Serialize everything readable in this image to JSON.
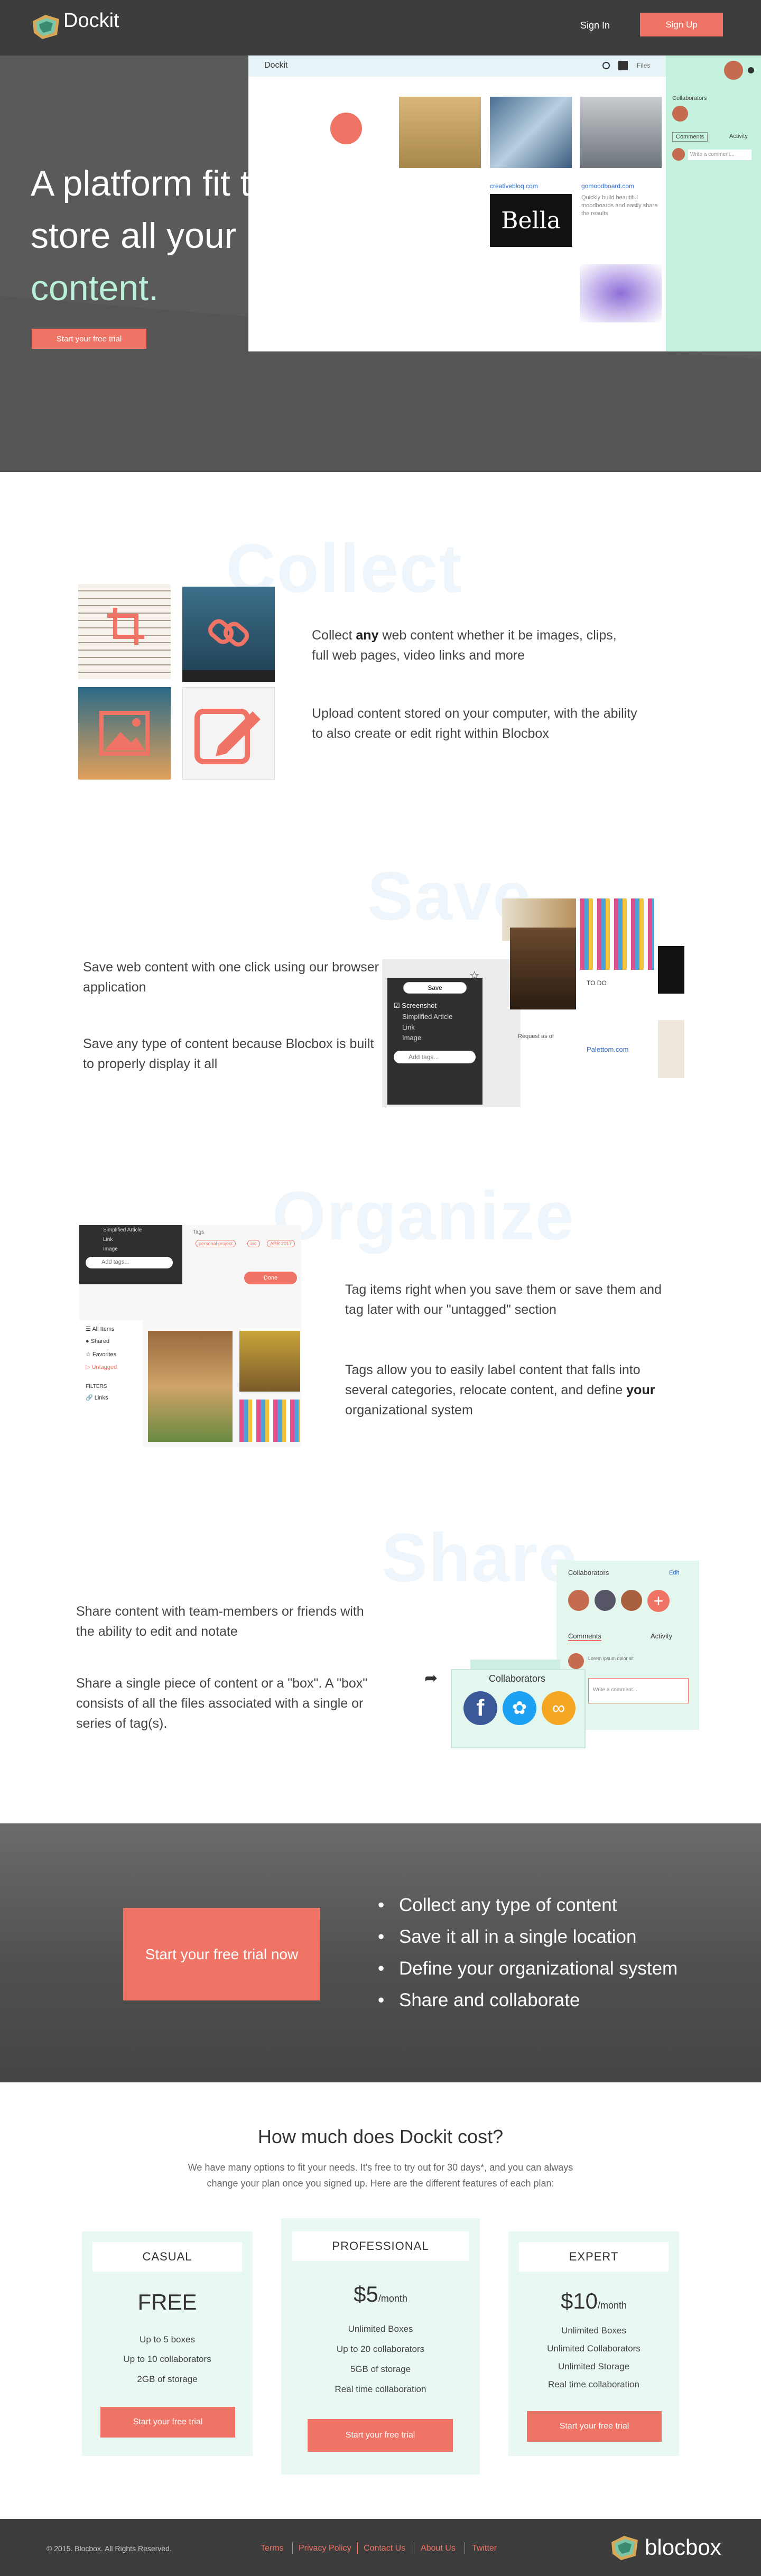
{
  "nav": {
    "brand": "Dockit",
    "signin": "Sign In",
    "signup": "Sign Up"
  },
  "hero": {
    "title_line1": "A platform fit to",
    "title_line2": "store all your",
    "title_line3": "content.",
    "cta": "Start your free trial"
  },
  "mock": {
    "app_title": "Dockit",
    "files_label": "Files",
    "collaborators": "Collaborators",
    "comments_tab": "Comments",
    "activity_tab": "Activity",
    "write_comment": "Write a comment...",
    "site1": "creativebloq.com",
    "site2": "gomoodboard.com",
    "bella": "Bella",
    "quick_note": "Quickly build beautiful moodboards and easily share the results"
  },
  "collect": {
    "ghost": "Collect",
    "p1_pre": "Collect ",
    "p1_bold": "any",
    "p1_post": " web content whether it be images, clips, full web pages, video links and more",
    "p2": "Upload content stored on your computer, with the ability to also create or edit right within Blocbox"
  },
  "save": {
    "ghost": "Save",
    "p1": "Save web content with one click using our browser application",
    "p2": "Save any type of content because Blocbox is built to properly display it all",
    "popup_save": "Save",
    "opt1": "Screenshot",
    "opt2": "Simplified Article",
    "opt3": "Link",
    "opt4": "Image",
    "add_tags": "Add tags...",
    "todo": "TO DO",
    "palette": "Palettom.com",
    "request": "Request as of"
  },
  "organize": {
    "ghost": "Organize",
    "p1": "Tag items right when you save them or save them and tag later with our \"untagged\" section",
    "p2_pre": "Tags allow you to easily label content that falls into several categories, relocate content, and define ",
    "p2_bold": "your",
    "p2_post": " organizational system",
    "menu1": "Simplified Article",
    "menu2": "Link",
    "menu3": "Image",
    "add_tags": "Add tags...",
    "tags_label": "Tags",
    "tag1": "personal project",
    "tag2": "inc",
    "tag3": "APR 2017",
    "done": "Done",
    "nav_all": "All Items",
    "nav_shared": "Shared",
    "nav_fav": "Favorites",
    "nav_untagged": "Untagged",
    "filters": "FILTERS",
    "links": "Links"
  },
  "share": {
    "ghost": "Share",
    "p1": "Share content with team-members or friends with the ability to edit and notate",
    "p2": "Share a single piece of content or a \"box\". A \"box\" consists of all the files associated with a single or series of tag(s).",
    "collaborators": "Collaborators",
    "edit": "Edit",
    "comments": "Comments",
    "activity": "Activity",
    "write_comment": "Write a comment...",
    "comment_text": "Lorem ipsum dolor sit"
  },
  "band": {
    "cta": "Start your free trial now",
    "bullets": [
      "Collect any type of content",
      "Save it all in a single location",
      "Define your organizational system",
      "Share and collaborate"
    ]
  },
  "pricing": {
    "title": "How much does Dockit cost?",
    "desc": "We have many options to fit your needs. It's free to try out for 30 days*, and you can always change your plan once you signed up. Here are the different features of each plan:",
    "plans": [
      {
        "name": "CASUAL",
        "price": "FREE",
        "per": "",
        "features": [
          "Up to 5 boxes",
          "Up to 10 collaborators",
          "2GB of storage"
        ],
        "cta": "Start your free trial"
      },
      {
        "name": "PROFESSIONAL",
        "price": "$5",
        "per": "/month",
        "features": [
          "Unlimited Boxes",
          "Up to 20 collaborators",
          "5GB of storage",
          "Real time collaboration"
        ],
        "cta": "Start your free trial"
      },
      {
        "name": "EXPERT",
        "price": "$10",
        "per": "/month",
        "features": [
          "Unlimited Boxes",
          "Unlimited Collaborators",
          "Unlimited Storage",
          "Real time collaboration"
        ],
        "cta": "Start your free trial"
      }
    ]
  },
  "footer": {
    "copyright": "© 2015. Blocbox. All Rights Reserved.",
    "links": [
      "Terms",
      "Privacy Policy",
      "Contact Us",
      "About Us",
      "Twitter"
    ],
    "brand": "blocbox"
  },
  "colors": {
    "accent": "#f07465",
    "mint": "#b8f0d8",
    "dark": "#3d3d3e"
  }
}
